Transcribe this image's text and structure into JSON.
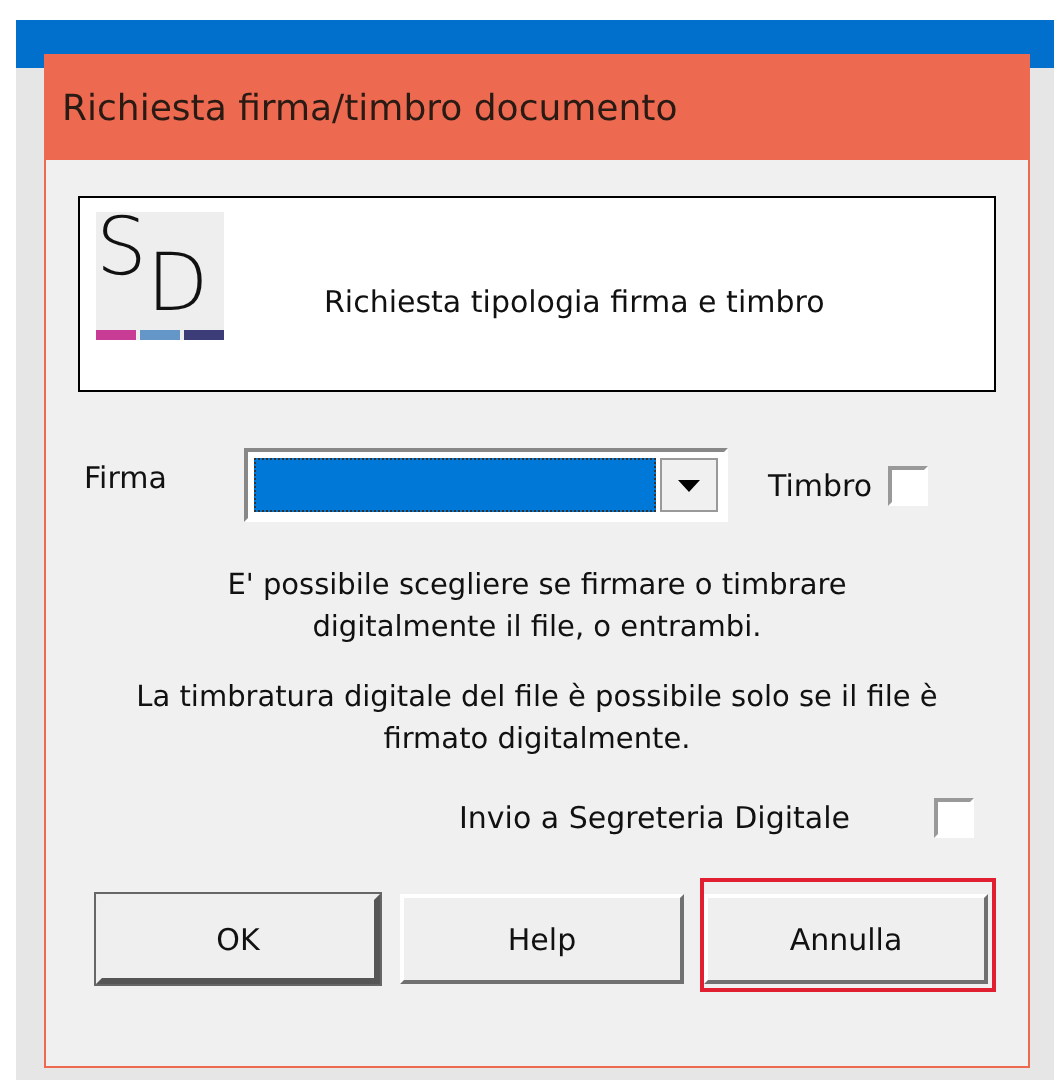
{
  "window": {
    "title": "Richiesta firma/timbro documento"
  },
  "header": {
    "logo_letters": [
      "S",
      "D"
    ],
    "logo_bars": [
      {
        "color": "#c83c96"
      },
      {
        "color": "#6496c8"
      },
      {
        "color": "#3c3c78"
      }
    ],
    "text": "Richiesta tipologia firma e timbro"
  },
  "firma": {
    "label": "Firma",
    "focused": true
  },
  "timbro": {
    "label": "Timbro",
    "checked": false
  },
  "info": [
    "E' possibile scegliere se firmare o timbrare digitalmente il file, o entrambi.",
    "La timbratura digitale del file è possibile solo se il file è firmato digitalmente."
  ],
  "invio": {
    "label": "Invio a Segreteria Digitale",
    "checked": false
  },
  "buttons": [
    {
      "label": "OK",
      "default": true,
      "highlighted": false
    },
    {
      "label": "Help",
      "default": false,
      "highlighted": false
    },
    {
      "label": "Annulla",
      "default": false,
      "highlighted": true
    }
  ]
}
